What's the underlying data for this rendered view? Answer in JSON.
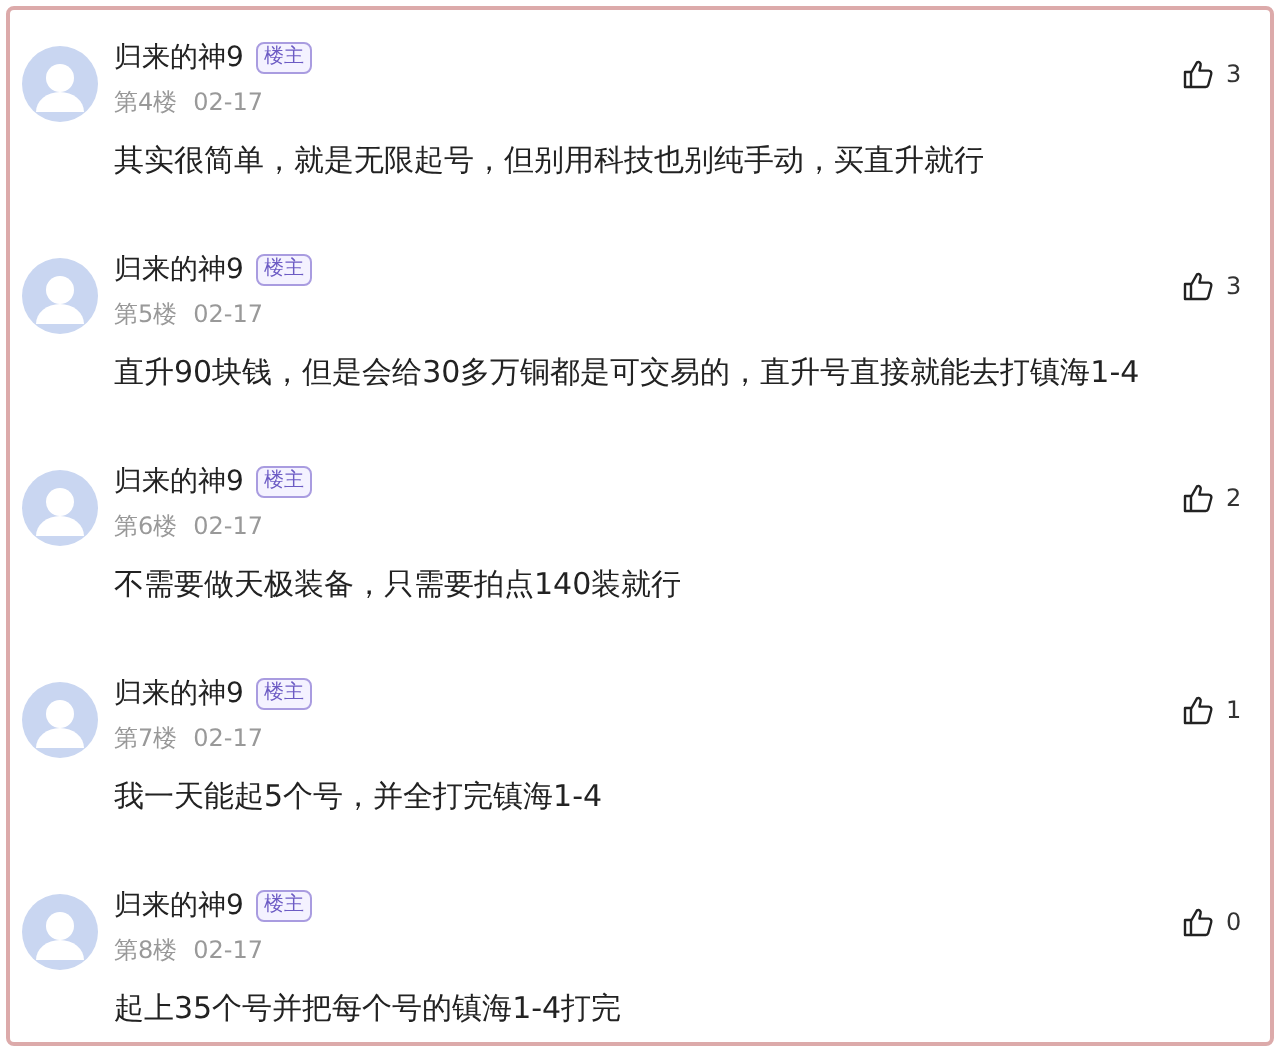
{
  "comments": [
    {
      "author": "归来的神9",
      "badge": "楼主",
      "floor": "第4楼",
      "date": "02-17",
      "text": "其实很简单，就是无限起号，但别用科技也别纯手动，买直升就行",
      "likes": "3"
    },
    {
      "author": "归来的神9",
      "badge": "楼主",
      "floor": "第5楼",
      "date": "02-17",
      "text": "直升90块钱，但是会给30多万铜都是可交易的，直升号直接就能去打镇海1-4",
      "likes": "3"
    },
    {
      "author": "归来的神9",
      "badge": "楼主",
      "floor": "第6楼",
      "date": "02-17",
      "text": "不需要做天极装备，只需要拍点140装就行",
      "likes": "2"
    },
    {
      "author": "归来的神9",
      "badge": "楼主",
      "floor": "第7楼",
      "date": "02-17",
      "text": "我一天能起5个号，并全打完镇海1-4",
      "likes": "1"
    },
    {
      "author": "归来的神9",
      "badge": "楼主",
      "floor": "第8楼",
      "date": "02-17",
      "text": "起上35个号并把每个号的镇海1-4打完",
      "likes": "0"
    }
  ]
}
